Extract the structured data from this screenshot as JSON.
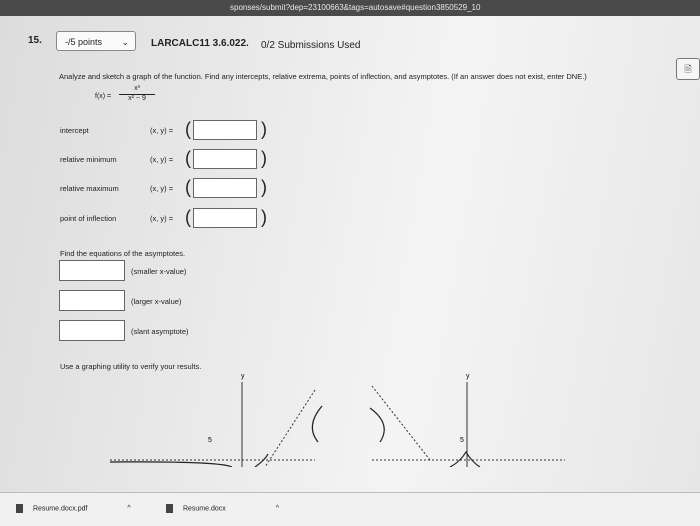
{
  "url_fragment": "sponses/submit?dep=23100663&tags=autosave#question3850529_10",
  "question": {
    "number": "15.",
    "points_label": "-/5 points",
    "id": "LARCALC11 3.6.022.",
    "submissions": "0/2 Submissions Used",
    "instruction": "Analyze and sketch a graph of the function. Find any intercepts, relative extrema, points of inflection, and asymptotes. (If an answer does not exist, enter DNE.)",
    "function_lhs": "f(x) =",
    "function_numerator": "x³",
    "function_denominator": "x² − 9"
  },
  "rows": [
    {
      "label": "intercept",
      "xy": "(x, y) ="
    },
    {
      "label": "relative minimum",
      "xy": "(x, y) ="
    },
    {
      "label": "relative maximum",
      "xy": "(x, y) ="
    },
    {
      "label": "point of inflection",
      "xy": "(x, y) ="
    }
  ],
  "asymptotes": {
    "title": "Find the equations of the asymptotes.",
    "items": [
      "(smaller x-value)",
      "(larger x-value)",
      "(slant asymptote)"
    ]
  },
  "verify_text": "Use a graphing utility to verify your results.",
  "graph_labels": {
    "y_axis": "y",
    "tick": "5"
  },
  "downloads": [
    {
      "name": "Resume.docx.pdf"
    },
    {
      "name": "Resume.docx"
    }
  ],
  "icons": {
    "side_button": "document-icon",
    "points_dropdown": "chevron-down-icon"
  }
}
